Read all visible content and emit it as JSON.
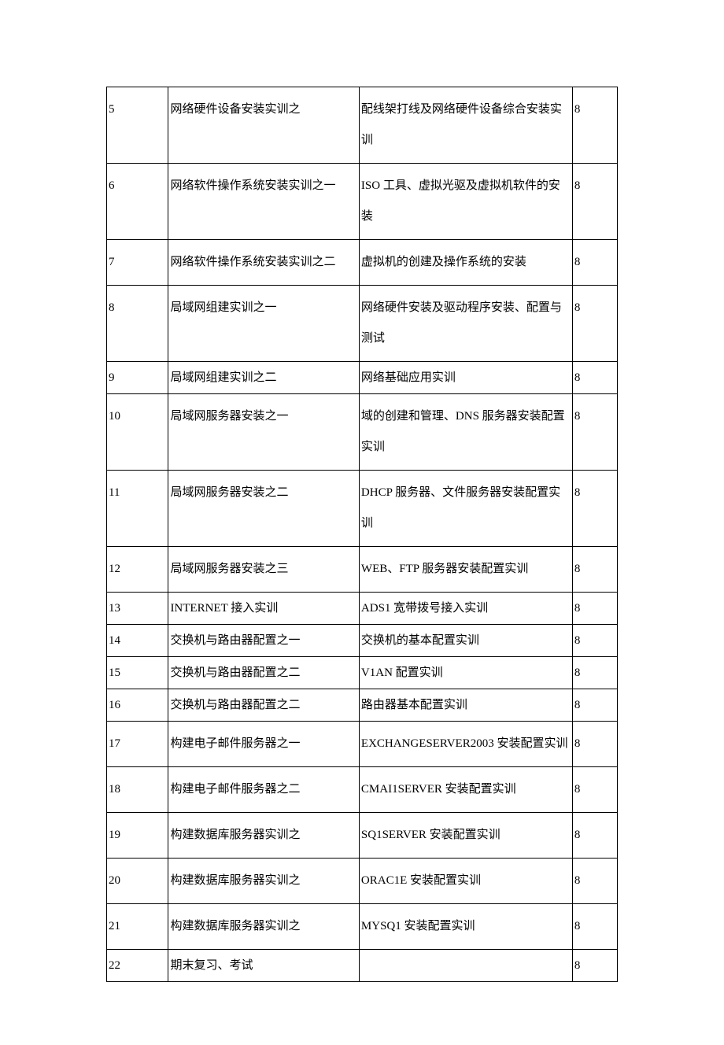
{
  "rows": [
    {
      "num": "5",
      "title": "网络硬件设备安装实训之",
      "content": "配线架打线及网络硬件设备综合安装实训",
      "hours": "8",
      "tight": false
    },
    {
      "num": "6",
      "title": "网络软件操作系统安装实训之一",
      "content": "ISO 工具、虚拟光驱及虚拟机软件的安装",
      "hours": "8",
      "tight": false
    },
    {
      "num": "7",
      "title": "网络软件操作系统安装实训之二",
      "content": "虚拟机的创建及操作系统的安装",
      "hours": "8",
      "tight": false
    },
    {
      "num": "8",
      "title": "局域网组建实训之一",
      "content": "网络硬件安装及驱动程序安装、配置与测试",
      "hours": "8",
      "tight": false
    },
    {
      "num": "9",
      "title": "局域网组建实训之二",
      "content": "网络基础应用实训",
      "hours": "8",
      "tight": true
    },
    {
      "num": "10",
      "title": "局域网服务器安装之一",
      "content": "域的创建和管理、DNS 服务器安装配置实训",
      "hours": "8",
      "tight": false
    },
    {
      "num": "11",
      "title": "局域网服务器安装之二",
      "content": "DHCP 服务器、文件服务器安装配置实训",
      "hours": "8",
      "tight": false
    },
    {
      "num": "12",
      "title": "局域网服务器安装之三",
      "content": "WEB、FTP 服务器安装配置实训",
      "hours": "8",
      "tight": false
    },
    {
      "num": "13",
      "title": "INTERNET 接入实训",
      "content": "ADS1 宽带拨号接入实训",
      "hours": "8",
      "tight": true
    },
    {
      "num": "14",
      "title": "交换机与路由器配置之一",
      "content": "交换机的基本配置实训",
      "hours": "8",
      "tight": true
    },
    {
      "num": "15",
      "title": "交换机与路由器配置之二",
      "content": "V1AN 配置实训",
      "hours": "8",
      "tight": true
    },
    {
      "num": "16",
      "title": "交换机与路由器配置之二",
      "content": "路由器基本配置实训",
      "hours": "8",
      "tight": true
    },
    {
      "num": "17",
      "title": "构建电子邮件服务器之一",
      "content": "EXCHANGESERVER2003 安装配置实训",
      "hours": "8",
      "tight": false
    },
    {
      "num": "18",
      "title": "构建电子邮件服务器之二",
      "content": "CMAI1SERVER 安装配置实训",
      "hours": "8",
      "tight": false
    },
    {
      "num": "19",
      "title": "构建数据库服务器实训之",
      "content": "\nSQ1SERVER 安装配置实训",
      "hours": "8",
      "tight": false
    },
    {
      "num": "20",
      "title": "构建数据库服务器实训之",
      "content": "ORAC1E 安装配置实训",
      "hours": "8",
      "tight": false
    },
    {
      "num": "21",
      "title": "构建数据库服务器实训之",
      "content": "MYSQ1 安装配置实训",
      "hours": "8",
      "tight": false
    },
    {
      "num": "22",
      "title": "期末复习、考试",
      "content": "",
      "hours": "8",
      "tight": true
    }
  ]
}
